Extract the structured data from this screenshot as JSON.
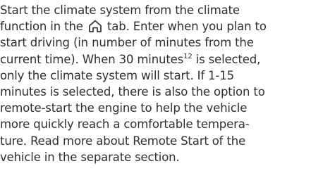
{
  "paragraph": {
    "l1": "Start the climate system from the climate",
    "l2_before_icon": "function in the",
    "l2_after_icon": "tab. Enter when you plan to",
    "l3": "start driving (in number of minutes from the",
    "l4_before_sup": "current time). When 30 minutes",
    "l4_sup": "12",
    "l4_after_sup": " is selected,",
    "l5": "only the climate system will start. If 1-15",
    "l6": "minutes is selected, there is also the option to",
    "l7": "remote-start the engine to help the vehicle",
    "l8": "more quickly reach a comfortable tempera-",
    "l9": "ture. Read more about Remote Start of the",
    "l10": "vehicle in the separate section."
  },
  "icons": {
    "home_tab": "home-icon"
  }
}
